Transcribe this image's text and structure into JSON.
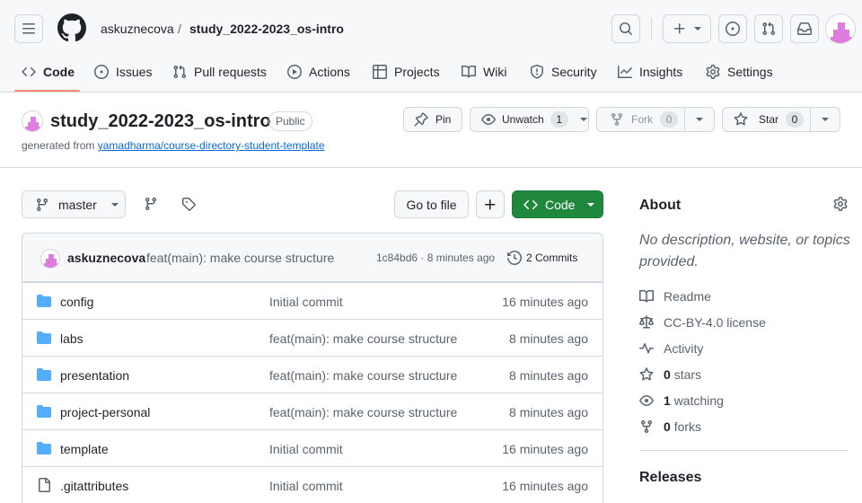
{
  "header": {
    "owner": "askuznecova",
    "separator": "/",
    "repo": "study_2022-2023_os-intro"
  },
  "nav": {
    "tabs": [
      {
        "label": "Code"
      },
      {
        "label": "Issues"
      },
      {
        "label": "Pull requests"
      },
      {
        "label": "Actions"
      },
      {
        "label": "Projects"
      },
      {
        "label": "Wiki"
      },
      {
        "label": "Security"
      },
      {
        "label": "Insights"
      },
      {
        "label": "Settings"
      }
    ]
  },
  "repo": {
    "title": "study_2022-2023_os-intro",
    "visibility": "Public",
    "generated_prefix": "generated from",
    "template_link": "yamadharma/course-directory-student-template",
    "pin_label": "Pin",
    "unwatch_label": "Unwatch",
    "watch_count": "1",
    "fork_label": "Fork",
    "fork_count": "0",
    "star_label": "Star",
    "star_count": "0"
  },
  "toolbar": {
    "branch": "master",
    "goto_file": "Go to file",
    "add": "+",
    "code_label": "Code"
  },
  "commit": {
    "author": "askuznecova",
    "message": "feat(main): make course structure",
    "hash_time": "1c84bd6 · 8 minutes ago",
    "commits_label": "2 Commits"
  },
  "files": [
    {
      "type": "folder",
      "name": "config",
      "message": "Initial commit",
      "age": "16 minutes ago"
    },
    {
      "type": "folder",
      "name": "labs",
      "message": "feat(main): make course structure",
      "age": "8 minutes ago"
    },
    {
      "type": "folder",
      "name": "presentation",
      "message": "feat(main): make course structure",
      "age": "8 minutes ago"
    },
    {
      "type": "folder",
      "name": "project-personal",
      "message": "feat(main): make course structure",
      "age": "8 minutes ago"
    },
    {
      "type": "folder",
      "name": "template",
      "message": "Initial commit",
      "age": "16 minutes ago"
    },
    {
      "type": "file",
      "name": ".gitattributes",
      "message": "Initial commit",
      "age": "16 minutes ago"
    }
  ],
  "about": {
    "heading": "About",
    "description": "No description, website, or topics provided.",
    "readme": "Readme",
    "license": "CC-BY-4.0 license",
    "activity": "Activity",
    "stars_count": "0",
    "stars_label": "stars",
    "watching_count": "1",
    "watching_label": "watching",
    "forks_count": "0",
    "forks_label": "forks",
    "releases_heading": "Releases"
  },
  "colors": {
    "accent_green": "#1f883d",
    "link_blue": "#0969da",
    "tab_underline": "#fd8c73",
    "avatar_pink": "#e07be0"
  },
  "icons": [
    "hamburger-icon",
    "github-logo-icon",
    "search-icon",
    "plus-icon",
    "issue-icon",
    "pull-request-icon",
    "inbox-icon",
    "code-icon",
    "play-icon",
    "table-icon",
    "book-icon",
    "shield-icon",
    "graph-icon",
    "gear-icon",
    "pin-icon",
    "eye-icon",
    "fork-icon",
    "star-icon",
    "branch-icon",
    "tag-icon",
    "history-icon",
    "folder-icon",
    "file-icon",
    "law-icon",
    "pulse-icon"
  ]
}
